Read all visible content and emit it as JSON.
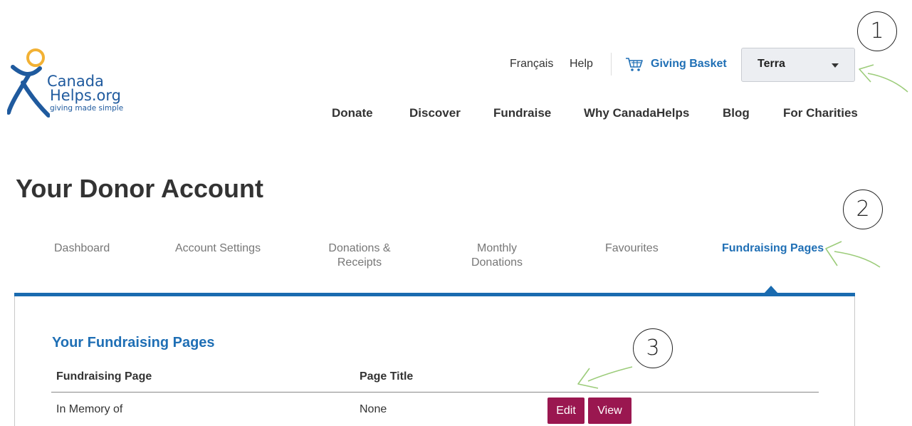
{
  "logo": {
    "line1": "Canada",
    "line2": "Helps.org",
    "tagline": "giving made simple"
  },
  "utility": {
    "language": "Français",
    "help": "Help",
    "basket": "Giving Basket",
    "account_name": "Terra"
  },
  "nav": {
    "items": [
      "Donate",
      "Discover",
      "Fundraise",
      "Why CanadaHelps",
      "Blog",
      "For Charities"
    ]
  },
  "page": {
    "title": "Your Donor Account"
  },
  "tabs": {
    "dashboard": "Dashboard",
    "account_settings": "Account Settings",
    "donations_line1": "Donations &",
    "donations_line2": "Receipts",
    "monthly_line1": "Monthly",
    "monthly_line2": "Donations",
    "favourites": "Favourites",
    "fundraising_pages": "Fundraising Pages"
  },
  "fundraising": {
    "section_title": "Your Fundraising Pages",
    "columns": [
      "Fundraising Page",
      "Page Title"
    ],
    "rows": [
      {
        "page": "In Memory of",
        "title": "None",
        "edit": "Edit",
        "view": "View"
      }
    ]
  },
  "annotations": [
    "1",
    "2",
    "3"
  ],
  "colors": {
    "brand_blue": "#1f6fb5",
    "tab_bar": "#1a6bb0",
    "button": "#9a1750",
    "logo_orange": "#f2b134",
    "arrow_green": "#9ccc7a"
  }
}
